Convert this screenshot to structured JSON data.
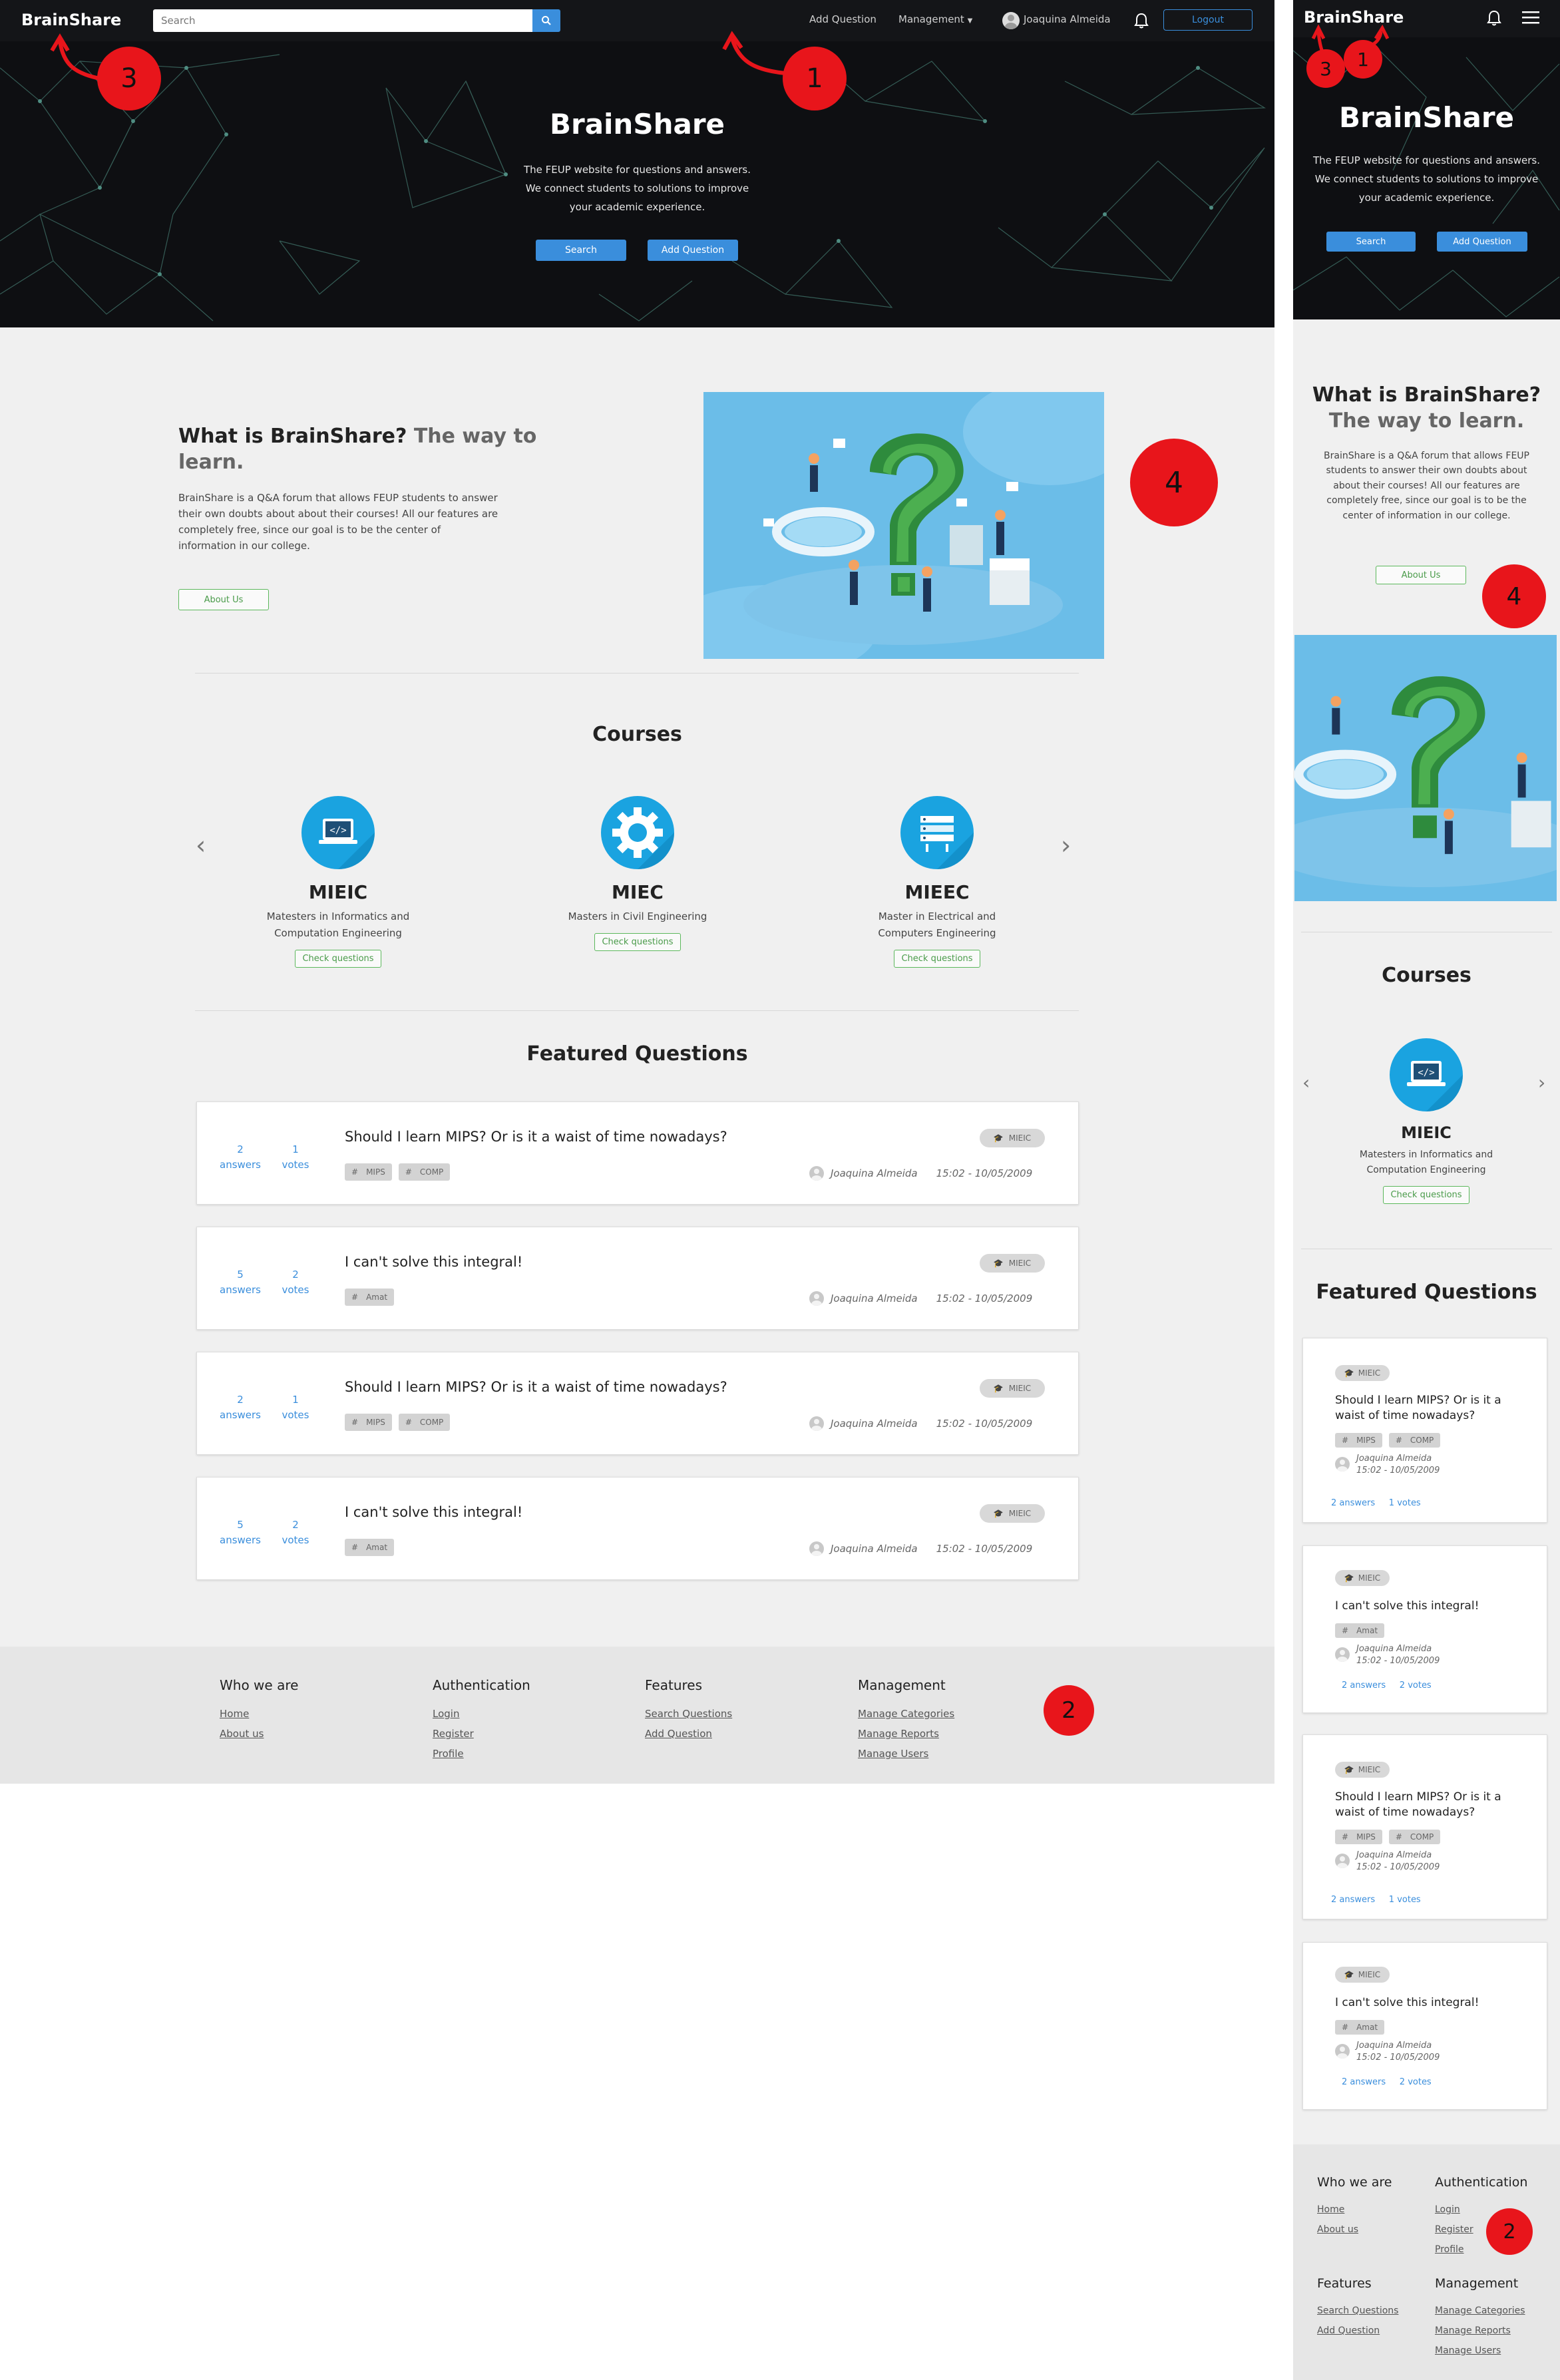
{
  "brand": "BrainShare",
  "nav": {
    "search_placeholder": "Search",
    "add_question": "Add Question",
    "management": "Management",
    "user_name": "Joaquina Almeida",
    "logout": "Logout"
  },
  "hero": {
    "title": "BrainShare",
    "line1": "The FEUP website for questions and answers.",
    "line2": "We connect students to solutions to improve",
    "line3": "your academic experience.",
    "search_btn": "Search",
    "add_btn": "Add Question"
  },
  "about": {
    "title": "What is BrainShare?",
    "subtitle": "The way to learn.",
    "text_lines": [
      "BrainShare is a Q&A forum that allows FEUP students to answer",
      "their own doubts about about their courses! All our features are",
      "completely free, since our goal is to be the center of",
      "information in our college."
    ],
    "mobile_text_lines": [
      "BrainShare is a Q&A forum that allows FEUP",
      "students to answer their own doubts about",
      "about their courses! All our features are",
      "completely free, since our goal is to be the",
      "center of information in our college."
    ],
    "button": "About Us"
  },
  "courses": {
    "title": "Courses",
    "items": [
      {
        "name": "MIEIC",
        "desc1": "Matesters in Informatics and",
        "desc2": "Computation Engineering",
        "button": "Check questions",
        "icon": "code-laptop-icon"
      },
      {
        "name": "MIEC",
        "desc1": "Masters in Civil Engineering",
        "desc2": "",
        "button": "Check questions",
        "icon": "gear-icon"
      },
      {
        "name": "MIEEC",
        "desc1": "Master in Electrical and",
        "desc2": "Computers Engineering",
        "button": "Check questions",
        "icon": "server-icon"
      }
    ]
  },
  "featured": {
    "title": "Featured Questions",
    "answers_label": "answers",
    "votes_label": "votes",
    "questions": [
      {
        "title": "Should I learn MIPS? Or is it a waist of time nowadays?",
        "mobile_title1": "Should I learn MIPS? Or is it a",
        "mobile_title2": "waist of time nowadays?",
        "answers": "2",
        "votes": "1",
        "tags": [
          "MIPS",
          "COMP"
        ],
        "course": "MIEIC",
        "author": "Joaquina Almeida",
        "time": "15:02 - 10/05/2009",
        "mobile_stats": "2 answers     1 votes"
      },
      {
        "title": "I can't solve this integral!",
        "mobile_title1": "I can't solve this integral!",
        "mobile_title2": "",
        "answers": "5",
        "votes": "2",
        "tags": [
          "Amat"
        ],
        "course": "MIEIC",
        "author": "Joaquina Almeida",
        "time": "15:02 - 10/05/2009",
        "mobile_stats": "2 answers     2 votes"
      },
      {
        "title": "Should I learn MIPS? Or is it a waist of time nowadays?",
        "mobile_title1": "Should I learn MIPS? Or is it a",
        "mobile_title2": "waist of time nowadays?",
        "answers": "2",
        "votes": "1",
        "tags": [
          "MIPS",
          "COMP"
        ],
        "course": "MIEIC",
        "author": "Joaquina Almeida",
        "time": "15:02 - 10/05/2009",
        "mobile_stats": "2 answers     1 votes"
      },
      {
        "title": "I can't solve this integral!",
        "mobile_title1": "I can't solve this integral!",
        "mobile_title2": "",
        "answers": "5",
        "votes": "2",
        "tags": [
          "Amat"
        ],
        "course": "MIEIC",
        "author": "Joaquina Almeida",
        "time": "15:02 - 10/05/2009",
        "mobile_stats": "2 answers     2 votes"
      }
    ]
  },
  "footer": {
    "who": {
      "title": "Who we are",
      "links": [
        "Home",
        "About us"
      ]
    },
    "auth": {
      "title": "Authentication",
      "links": [
        "Login",
        "Register",
        "Profile"
      ]
    },
    "features": {
      "title": "Features",
      "links": [
        "Search Questions",
        "Add Question"
      ]
    },
    "management": {
      "title": "Management",
      "links": [
        "Manage Categories",
        "Manage Reports",
        "Manage Users"
      ]
    }
  },
  "markers": [
    "1",
    "2",
    "3",
    "4"
  ],
  "colors": {
    "accent": "#3a8edc",
    "dark": "#141518",
    "green": "#5cb85c",
    "marker": "#e8151b"
  }
}
